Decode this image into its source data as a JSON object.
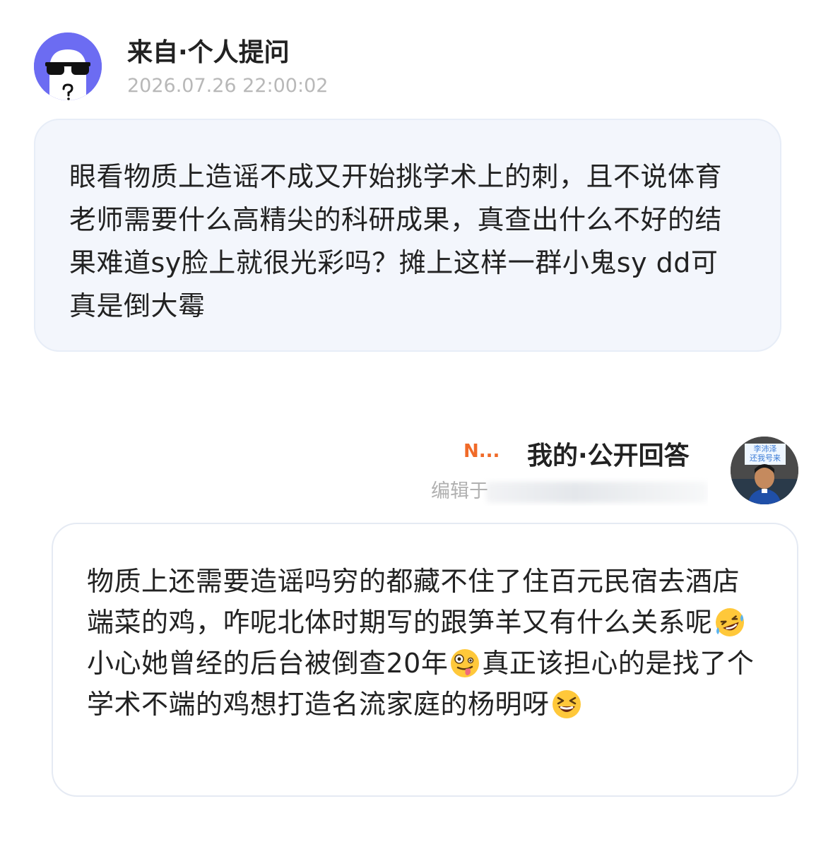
{
  "question": {
    "avatar_icon": "sunglasses-ghost-avatar-icon",
    "title": "来自·个人提问",
    "timestamp": "2026.07.26 22:00:02",
    "text": "眼看物质上造谣不成又开始挑学术上的刺，且不说体育老师需要什么高精尖的科研成果，真查出什么不好的结果难道sy脸上就很光彩吗？摊上这样一群小鬼sy dd可真是倒大霉"
  },
  "answer": {
    "username": "N...",
    "title": "我的·公开回答",
    "edited_prefix": "编辑于",
    "avatar_sign_line1": "李沛泽",
    "avatar_sign_line2": "还我号来",
    "segments": {
      "part1": "物质上还需要造谣吗穷的都藏不住了住百元民宿去酒店端菜的鸡，咋呢北体时期写的跟笋羊又有什么关系呢",
      "emoji1": "rofl-emoji-icon",
      "part2": "小心她曾经的后台被倒查20年",
      "emoji2": "zany-face-emoji-icon",
      "part3": "真正该担心的是找了个学术不端的鸡想打造名流家庭的杨明呀",
      "emoji3": "grinning-squinting-emoji-icon"
    }
  },
  "colors": {
    "question_bubble": "#f3f6fc",
    "username_accent": "#f06a28",
    "avatar_purple": "#6c6cf2",
    "timestamp_gray": "#b8b8b8"
  }
}
